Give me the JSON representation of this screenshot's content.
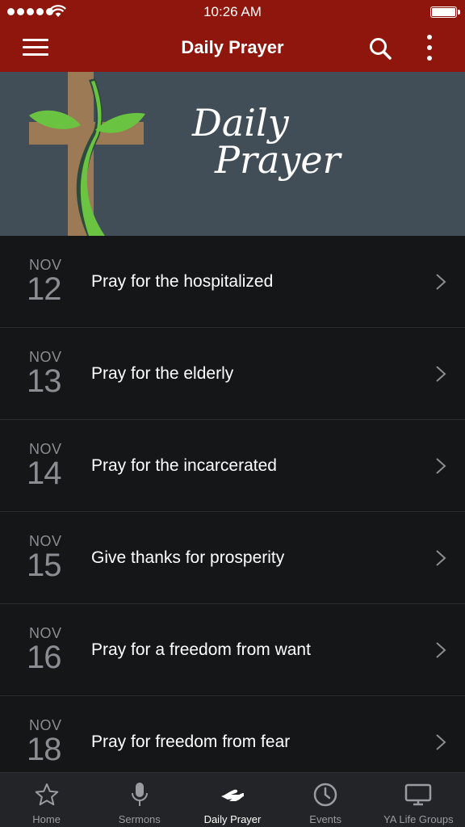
{
  "status_bar": {
    "time": "10:26 AM"
  },
  "nav": {
    "title": "Daily Prayer"
  },
  "banner": {
    "line1": "Daily",
    "line2": "Prayer"
  },
  "prayers": [
    {
      "month": "NOV",
      "day": "12",
      "text": "Pray for the hospitalized"
    },
    {
      "month": "NOV",
      "day": "13",
      "text": "Pray for the elderly"
    },
    {
      "month": "NOV",
      "day": "14",
      "text": "Pray for the incarcerated"
    },
    {
      "month": "NOV",
      "day": "15",
      "text": "Give thanks for prosperity"
    },
    {
      "month": "NOV",
      "day": "16",
      "text": "Pray for a freedom from want"
    },
    {
      "month": "NOV",
      "day": "18",
      "text": "Pray for freedom from fear"
    }
  ],
  "tabs": [
    {
      "label": "Home",
      "icon": "star-icon"
    },
    {
      "label": "Sermons",
      "icon": "microphone-icon"
    },
    {
      "label": "Daily Prayer",
      "icon": "praying-hands-icon",
      "active": true
    },
    {
      "label": "Events",
      "icon": "clock-icon"
    },
    {
      "label": "YA Life Groups",
      "icon": "monitor-icon"
    }
  ],
  "colors": {
    "header": "#8e160c",
    "background": "#151618",
    "banner": "#414e58",
    "tab_bar": "#232427",
    "muted_text": "#8b8d92"
  }
}
